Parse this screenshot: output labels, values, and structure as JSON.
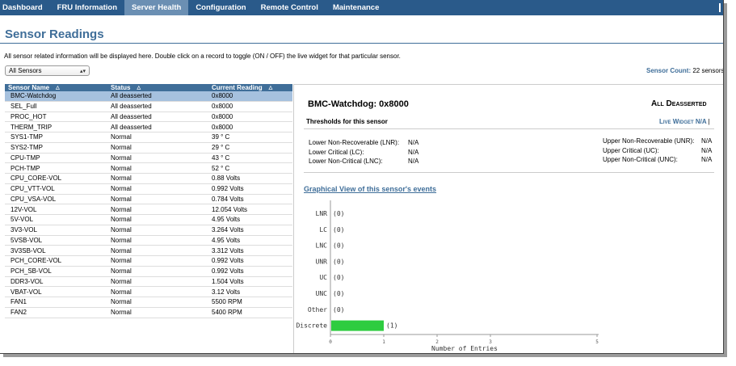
{
  "nav": {
    "items": [
      {
        "label": "Dashboard",
        "name": "nav-dashboard",
        "active": false
      },
      {
        "label": "FRU Information",
        "name": "nav-fru-information",
        "active": false
      },
      {
        "label": "Server Health",
        "name": "nav-server-health",
        "active": true
      },
      {
        "label": "Configuration",
        "name": "nav-configuration",
        "active": false
      },
      {
        "label": "Remote Control",
        "name": "nav-remote-control",
        "active": false
      },
      {
        "label": "Maintenance",
        "name": "nav-maintenance",
        "active": false
      }
    ]
  },
  "page": {
    "title": "Sensor Readings",
    "description": "All sensor related information will be displayed here. Double click on a record to toggle (ON / OFF) the live widget for that particular sensor.",
    "filter_value": "All Sensors",
    "sensor_count_label": "Sensor Count:",
    "sensor_count_value": "22 sensors"
  },
  "table": {
    "headers": [
      "Sensor Name",
      "Status",
      "Current Reading"
    ],
    "rows": [
      {
        "name": "BMC-Watchdog",
        "status": "All deasserted",
        "reading": "0x8000",
        "selected": true
      },
      {
        "name": "SEL_Full",
        "status": "All deasserted",
        "reading": "0x8000"
      },
      {
        "name": "PROC_HOT",
        "status": "All deasserted",
        "reading": "0x8000"
      },
      {
        "name": "THERM_TRIP",
        "status": "All deasserted",
        "reading": "0x8000"
      },
      {
        "name": "SYS1-TMP",
        "status": "Normal",
        "reading": "39 ° C"
      },
      {
        "name": "SYS2-TMP",
        "status": "Normal",
        "reading": "29 ° C"
      },
      {
        "name": "CPU-TMP",
        "status": "Normal",
        "reading": "43 ° C"
      },
      {
        "name": "PCH-TMP",
        "status": "Normal",
        "reading": "52 ° C"
      },
      {
        "name": "CPU_CORE-VOL",
        "status": "Normal",
        "reading": "0.88 Volts"
      },
      {
        "name": "CPU_VTT-VOL",
        "status": "Normal",
        "reading": "0.992 Volts"
      },
      {
        "name": "CPU_VSA-VOL",
        "status": "Normal",
        "reading": "0.784 Volts"
      },
      {
        "name": "12V-VOL",
        "status": "Normal",
        "reading": "12.054 Volts"
      },
      {
        "name": "5V-VOL",
        "status": "Normal",
        "reading": "4.95 Volts"
      },
      {
        "name": "3V3-VOL",
        "status": "Normal",
        "reading": "3.264 Volts"
      },
      {
        "name": "5VSB-VOL",
        "status": "Normal",
        "reading": "4.95 Volts"
      },
      {
        "name": "3V3SB-VOL",
        "status": "Normal",
        "reading": "3.312 Volts"
      },
      {
        "name": "PCH_CORE-VOL",
        "status": "Normal",
        "reading": "0.992 Volts"
      },
      {
        "name": "PCH_SB-VOL",
        "status": "Normal",
        "reading": "0.992 Volts"
      },
      {
        "name": "DDR3-VOL",
        "status": "Normal",
        "reading": "1.504 Volts"
      },
      {
        "name": "VBAT-VOL",
        "status": "Normal",
        "reading": "3.12 Volts"
      },
      {
        "name": "FAN1",
        "status": "Normal",
        "reading": "5500 RPM"
      },
      {
        "name": "FAN2",
        "status": "Normal",
        "reading": "5400 RPM"
      }
    ]
  },
  "detail": {
    "sensor": "BMC-Watchdog: 0x8000",
    "state": "All Deasserted",
    "thresholds_title": "Thresholds for this sensor",
    "live_widget_label": "Live Widget",
    "live_widget_value": "N/A",
    "live_widget_sep": "|",
    "lower": [
      {
        "label": "Lower Non-Recoverable (LNR):",
        "value": "N/A"
      },
      {
        "label": "Lower Critical (LC):",
        "value": "N/A"
      },
      {
        "label": "Lower Non-Critical (LNC):",
        "value": "N/A"
      }
    ],
    "upper": [
      {
        "label": "Upper Non-Recoverable (UNR):",
        "value": "N/A"
      },
      {
        "label": "Upper Critical (UC):",
        "value": "N/A"
      },
      {
        "label": "Upper Non-Critical (UNC):",
        "value": "N/A"
      }
    ],
    "graph_link": "Graphical View of this sensor's events"
  },
  "colors": {
    "nav_bg": "#2a5a8a",
    "accent": "#3f6e99",
    "bar": "#2ecc40"
  },
  "chart_data": {
    "type": "bar",
    "orientation": "horizontal",
    "categories": [
      "LNR",
      "LC",
      "LNC",
      "UNR",
      "UC",
      "UNC",
      "Other",
      "Discrete"
    ],
    "values": [
      0,
      0,
      0,
      0,
      0,
      0,
      0,
      1
    ],
    "value_labels": [
      "(0)",
      "(0)",
      "(0)",
      "(0)",
      "(0)",
      "(0)",
      "(0)",
      "(1)"
    ],
    "xlabel": "Number of Entries",
    "xticks": [
      0,
      1,
      2,
      3,
      5
    ],
    "xlim": [
      0,
      5
    ]
  }
}
